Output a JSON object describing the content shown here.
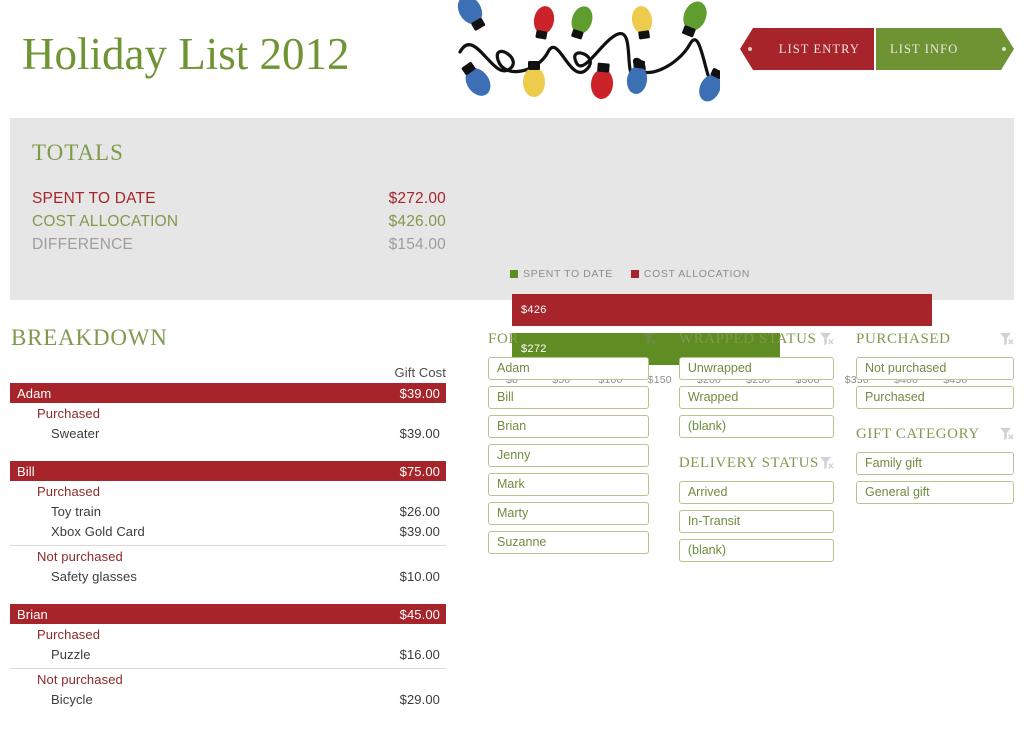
{
  "header": {
    "title": "Holiday List 2012",
    "nav": [
      {
        "label": "LIST ENTRY",
        "color": "#a7242a",
        "name": "list-entry"
      },
      {
        "label": "LIST INFO",
        "color": "#6d9333",
        "name": "list-info"
      }
    ],
    "decoration": "christmas-lights-string"
  },
  "totals": {
    "heading": "TOTALS",
    "rows": [
      {
        "label": "SPENT TO DATE",
        "value": "$272.00",
        "color": "#a7242a"
      },
      {
        "label": "COST ALLOCATION",
        "value": "$426.00",
        "color": "#7e9a4d"
      },
      {
        "label": "DIFFERENCE",
        "value": "$154.00",
        "color": "#9e9e9e"
      }
    ]
  },
  "chart_data": {
    "type": "bar",
    "orientation": "horizontal",
    "title": "",
    "xlabel": "",
    "ylabel": "",
    "xlim": [
      0,
      470
    ],
    "grid": false,
    "legend_position": "top-left",
    "categories": [
      "COST ALLOCATION",
      "SPENT TO DATE"
    ],
    "series": [
      {
        "name": "COST ALLOCATION",
        "values": [
          426
        ],
        "label": "$426",
        "color": "#a7242a"
      },
      {
        "name": "SPENT TO DATE",
        "values": [
          272
        ],
        "label": "$272",
        "color": "#5f8c23"
      }
    ],
    "legend": [
      {
        "label": "SPENT TO DATE",
        "color": "#5f8c23"
      },
      {
        "label": "COST ALLOCATION",
        "color": "#a7242a"
      }
    ],
    "tick_labels": [
      "$0",
      "$50",
      "$100",
      "$150",
      "$200",
      "$250",
      "$300",
      "$350",
      "$400",
      "$450"
    ],
    "tick_values": [
      0,
      50,
      100,
      150,
      200,
      250,
      300,
      350,
      400,
      450
    ]
  },
  "breakdown": {
    "heading": "BREAKDOWN",
    "cost_column_header": "Gift Cost",
    "groups": [
      {
        "name": "Adam",
        "total": "$39.00",
        "sections": [
          {
            "label": "Purchased",
            "items": [
              {
                "name": "Sweater",
                "cost": "$39.00"
              }
            ]
          }
        ]
      },
      {
        "name": "Bill",
        "total": "$75.00",
        "sections": [
          {
            "label": "Purchased",
            "items": [
              {
                "name": "Toy train",
                "cost": "$26.00"
              },
              {
                "name": "Xbox Gold Card",
                "cost": "$39.00"
              }
            ]
          },
          {
            "label": "Not purchased",
            "items": [
              {
                "name": "Safety glasses",
                "cost": "$10.00"
              }
            ]
          }
        ]
      },
      {
        "name": "Brian",
        "total": "$45.00",
        "sections": [
          {
            "label": "Purchased",
            "items": [
              {
                "name": "Puzzle",
                "cost": "$16.00"
              }
            ]
          },
          {
            "label": "Not purchased",
            "items": [
              {
                "name": "Bicycle",
                "cost": "$29.00"
              }
            ]
          }
        ]
      }
    ]
  },
  "slicers": [
    {
      "title": "FOR",
      "name": "for",
      "clear_icon": "clear-filter-icon",
      "options": [
        "Adam",
        "Bill",
        "Brian",
        "Jenny",
        "Mark",
        "Marty",
        "Suzanne"
      ]
    },
    {
      "title": "WRAPPED STATUS",
      "name": "wrapped-status",
      "clear_icon": "clear-filter-icon",
      "options": [
        "Unwrapped",
        "Wrapped",
        "(blank)"
      ]
    },
    {
      "title": "PURCHASED",
      "name": "purchased",
      "clear_icon": "clear-filter-icon",
      "options": [
        "Not purchased",
        "Purchased"
      ]
    },
    {
      "title": "DELIVERY STATUS",
      "name": "delivery-status",
      "clear_icon": "clear-filter-icon",
      "options": [
        "Arrived",
        "In-Transit",
        "(blank)"
      ]
    },
    {
      "title": "GIFT CATEGORY",
      "name": "gift-category",
      "clear_icon": "clear-filter-icon",
      "options": [
        "Family gift",
        "General gift"
      ]
    }
  ]
}
